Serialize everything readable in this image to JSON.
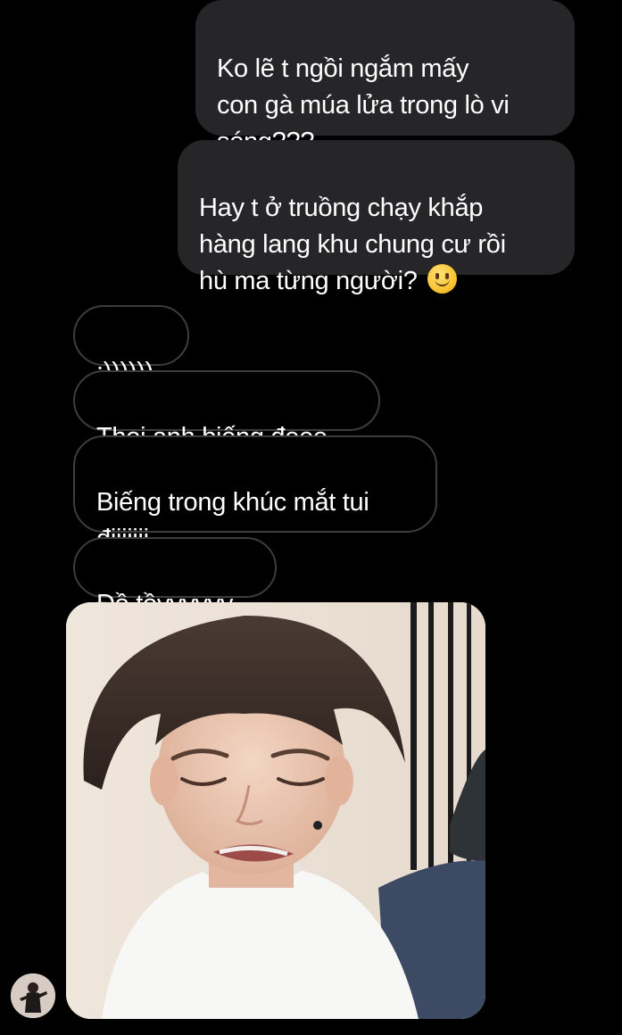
{
  "conversation": {
    "sent_messages": [
      {
        "text": "Ko lẽ t ngồi ngắm mấy\ncon gà múa lửa trong lò vi\nsóng???"
      },
      {
        "text": "Hay t ở truồng chạy khắp\nhàng lang khu chung cư rồi\nhù ma từng người? ",
        "emoji": "slightly-smiling-face-emoji"
      }
    ],
    "received_messages": [
      {
        "text": ":))))))"
      },
      {
        "text": "Thoi anh biếng đeee"
      },
      {
        "text": "Biếng trong khúc mắt tui\nđiiiiiii"
      },
      {
        "text": "Đồ tồyyyyyy"
      }
    ],
    "attachment": {
      "type": "photo",
      "subject": "crying-face-meme-photo"
    },
    "contact_avatar": "contact-avatar"
  },
  "colors": {
    "background": "#000000",
    "sent_bubble": "#262628",
    "received_border": "#3d3d40",
    "text": "#ffffff"
  }
}
